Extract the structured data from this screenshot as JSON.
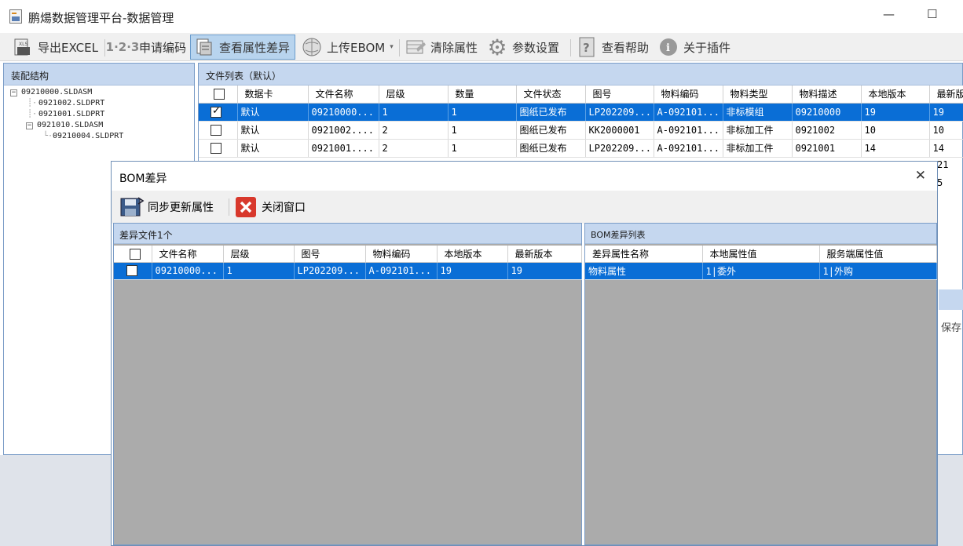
{
  "window": {
    "title": "鹏煬数据管理平台-数据管理"
  },
  "toolbar": [
    {
      "label": "导出EXCEL",
      "icon": "excel-export-icon",
      "active": false
    },
    {
      "label": "申请编码",
      "icon": "123-code-icon",
      "active": false
    },
    {
      "label": "查看属性差异",
      "icon": "document-compare-icon",
      "active": true
    },
    {
      "label": "上传EBOM",
      "icon": "globe-upload-icon",
      "active": false
    },
    {
      "label": "清除属性",
      "icon": "eraser-table-icon",
      "active": false
    },
    {
      "label": "参数设置",
      "icon": "gear-icon",
      "active": false
    },
    {
      "label": "查看帮助",
      "icon": "help-book-icon",
      "active": false
    },
    {
      "label": "关于插件",
      "icon": "info-icon",
      "active": false
    }
  ],
  "assembly": {
    "header": "装配结构",
    "nodes": [
      "09210000.SLDASM",
      "0921002.SLDPRT",
      "0921001.SLDPRT",
      "0921010.SLDASM",
      "09210004.SLDPRT"
    ]
  },
  "file_list": {
    "header": "文件列表（默认）",
    "columns": [
      "",
      "数据卡",
      "文件名称",
      "层级",
      "数量",
      "文件状态",
      "图号",
      "物料编码",
      "物料类型",
      "物料描述",
      "本地版本",
      "最新版"
    ],
    "rows": [
      {
        "checked": true,
        "selected": true,
        "cells": [
          "默认",
          "09210000...",
          "1",
          "1",
          "图纸已发布",
          "LP202209...",
          "A-092101...",
          "非标模组",
          "09210000",
          "19",
          "19"
        ]
      },
      {
        "checked": false,
        "selected": false,
        "cells": [
          "默认",
          "0921002....",
          "2",
          "1",
          "图纸已发布",
          "KK2000001",
          "A-092101...",
          "非标加工件",
          "0921002",
          "10",
          "10"
        ]
      },
      {
        "checked": false,
        "selected": false,
        "cells": [
          "默认",
          "0921001....",
          "2",
          "1",
          "图纸已发布",
          "LP202209...",
          "A-092101...",
          "非标加工件",
          "0921001",
          "14",
          "14"
        ]
      }
    ],
    "overflow_values": [
      "21",
      "5"
    ],
    "side_label": "保存"
  },
  "dialog": {
    "title": "BOM差异",
    "sync_button": "同步更新属性",
    "close_button": "关闭窗口",
    "left": {
      "header": "差异文件1个",
      "columns": [
        "",
        "文件名称",
        "层级",
        "图号",
        "物料编码",
        "本地版本",
        "最新版本"
      ],
      "rows": [
        {
          "checked": false,
          "cells": [
            "09210000...",
            "1",
            "LP202209...",
            "A-092101...",
            "19",
            "19"
          ]
        }
      ]
    },
    "right": {
      "header": "BOM差异列表",
      "columns": [
        "差异属性名称",
        "本地属性值",
        "服务端属性值"
      ],
      "rows": [
        {
          "cells": [
            "物料属性",
            "1|委外",
            "1|外购"
          ]
        }
      ]
    }
  },
  "colors": {
    "selection": "#0a6ed6",
    "panel_header": "#c5d7ef",
    "panel_border": "#7a9cc7"
  }
}
